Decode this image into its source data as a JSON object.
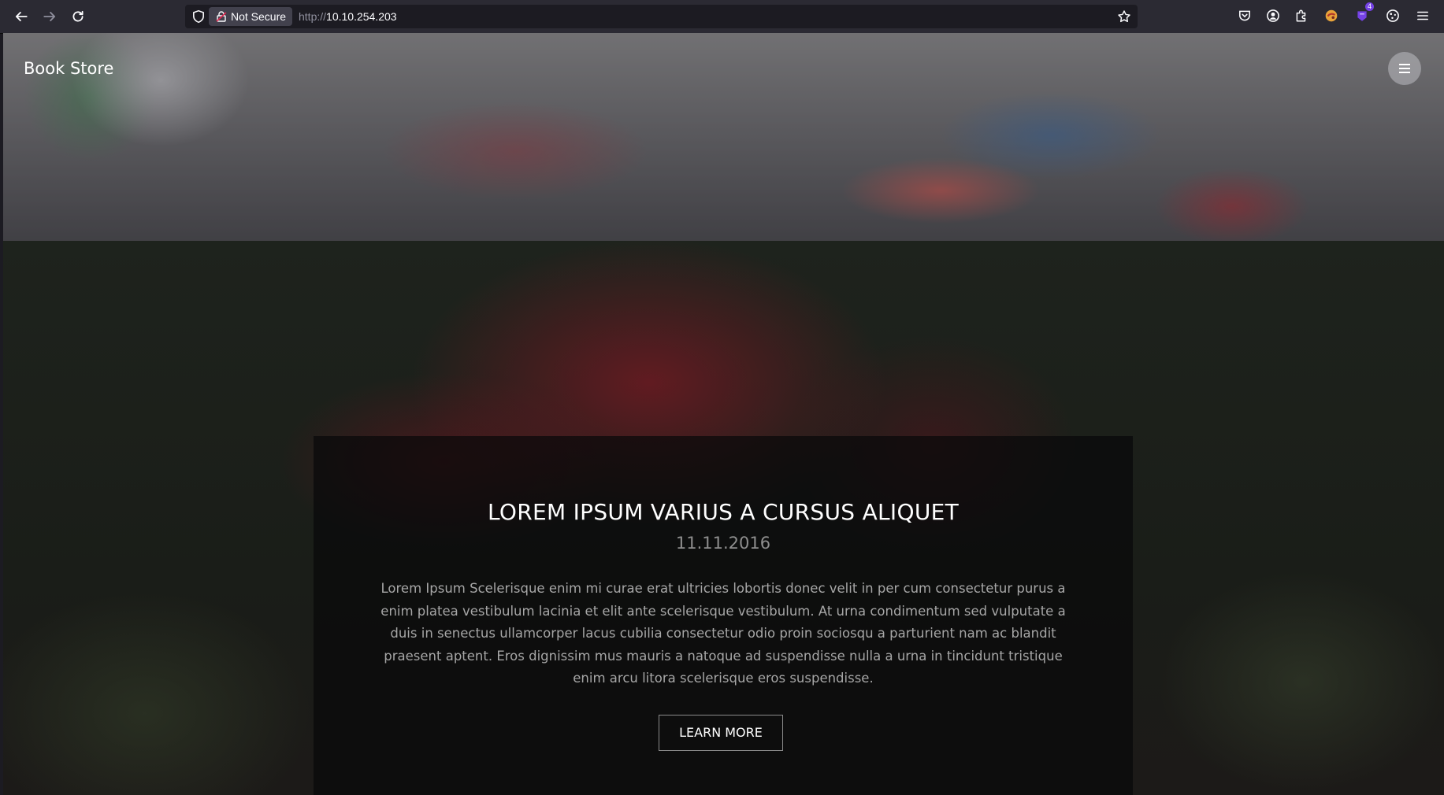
{
  "browser": {
    "security_label": "Not Secure",
    "url_protocol": "http://",
    "url_host": "10.10.254.203",
    "extension_badge": "4",
    "icons": [
      "back-icon",
      "forward-icon",
      "reload-icon",
      "shield-icon",
      "lock-icon",
      "bookmark-star-icon",
      "pocket-icon",
      "account-icon",
      "extensions-icon",
      "extension-icon",
      "hamburger-menu-icon"
    ]
  },
  "site": {
    "brand": "Book Store"
  },
  "article": {
    "title": "LOREM IPSUM VARIUS A CURSUS ALIQUET",
    "date": "11.11.2016",
    "body": "Lorem Ipsum Scelerisque enim mi curae erat ultricies lobortis donec velit in per cum consectetur purus a enim platea vestibulum lacinia et elit ante scelerisque vestibulum. At urna condimentum sed vulputate a duis in senectus ullamcorper lacus cubilia consectetur odio proin sociosqu a parturient nam ac blandit praesent aptent. Eros dignissim mus mauris a natoque ad suspendisse nulla a urna in tincidunt tristique enim arcu litora scelerisque eros suspendisse.",
    "cta_label": "LEARN MORE"
  }
}
